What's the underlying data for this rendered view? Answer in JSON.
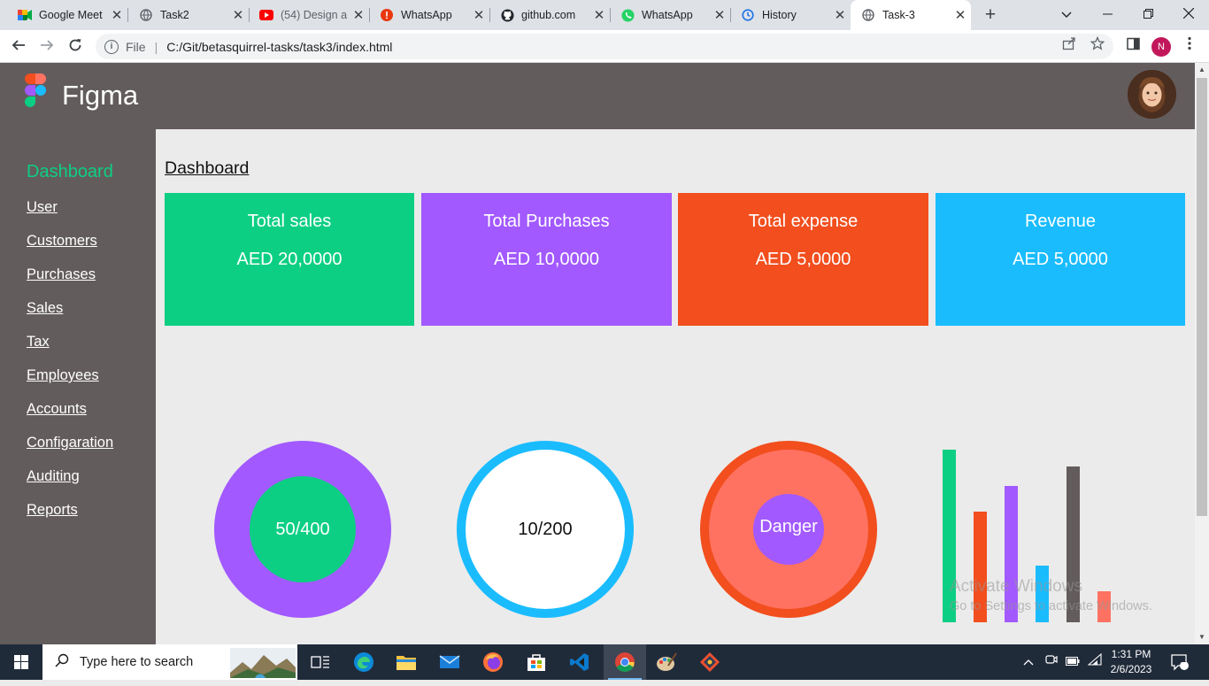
{
  "browser": {
    "tabs": [
      {
        "title": "Google Meet",
        "icon": "google-meet-icon"
      },
      {
        "title": "Task2",
        "icon": "globe-icon"
      },
      {
        "title": "(54) Design a",
        "icon": "youtube-icon"
      },
      {
        "title": "WhatsApp",
        "icon": "notification-icon"
      },
      {
        "title": "github.com",
        "icon": "github-icon"
      },
      {
        "title": "WhatsApp",
        "icon": "whatsapp-icon"
      },
      {
        "title": "History",
        "icon": "history-icon"
      },
      {
        "title": "Task-3",
        "icon": "globe-icon",
        "active": true
      }
    ],
    "address": {
      "scheme_label": "File",
      "url": "C:/Git/betasquirrel-tasks/task3/index.html"
    },
    "profile_initial": "N"
  },
  "app": {
    "brand": "Figma",
    "sidebar": {
      "title": "Dashboard",
      "items": [
        "User",
        "Customers",
        "Purchases",
        "Sales",
        "Tax",
        "Employees",
        "Accounts",
        "Configaration",
        "Auditing",
        "Reports"
      ]
    },
    "main_title": "Dashboard",
    "cards": [
      {
        "title": "Total sales",
        "value": "AED 20,0000",
        "color": "#0dcf83"
      },
      {
        "title": "Total Purchases",
        "value": "AED 10,0000",
        "color": "#a259ff"
      },
      {
        "title": "Total expense",
        "value": "AED 5,0000",
        "color": "#f24e1e"
      },
      {
        "title": "Revenue",
        "value": "AED 5,0000",
        "color": "#1abcfe"
      }
    ],
    "rings": [
      {
        "label": "50/400"
      },
      {
        "label": "10/200"
      },
      {
        "label": "Danger"
      }
    ],
    "bars": [
      {
        "level": 1.0,
        "color": "#0dcf83"
      },
      {
        "level": 0.64,
        "color": "#f24e1e"
      },
      {
        "level": 0.79,
        "color": "#a259ff"
      },
      {
        "level": 0.33,
        "color": "#1abcfe"
      },
      {
        "level": 0.9,
        "color": "#635c5c"
      },
      {
        "level": 0.18,
        "color": "#ff7262"
      }
    ]
  },
  "watermark": {
    "line1": "Activate Windows",
    "line2": "Go to Settings to activate Windows."
  },
  "taskbar": {
    "search_placeholder": "Type here to search",
    "time": "1:31 PM",
    "date": "2/6/2023",
    "notification_count": "2"
  }
}
